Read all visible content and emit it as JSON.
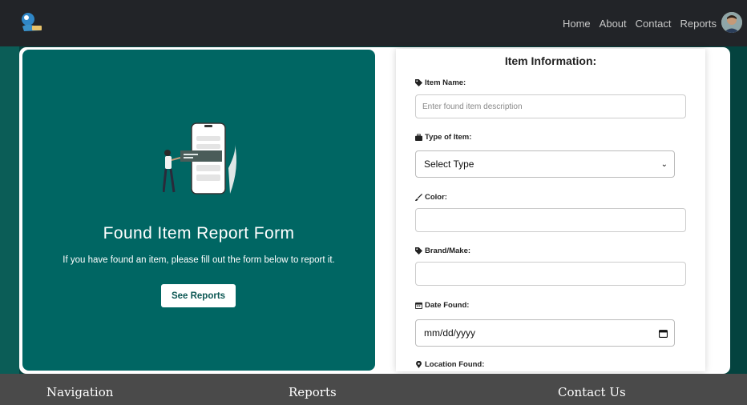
{
  "navbar": {
    "logo_icon": "lost-and-found-logo",
    "links": [
      "Home",
      "About",
      "Contact",
      "Reports"
    ],
    "avatar_icon": "user-avatar"
  },
  "hero": {
    "title": "Found Item Report Form",
    "text": "If you have found an item, please fill out the form below to report it.",
    "button_label": "See Reports",
    "illustration": "person-with-phone-illustration",
    "bg_color": "#006663"
  },
  "form": {
    "title": "Item Information:",
    "fields": {
      "item_name": {
        "label": "Item Name:",
        "icon": "tag-icon",
        "placeholder": "Enter found item description",
        "value": ""
      },
      "type": {
        "label": "Type of Item:",
        "icon": "briefcase-icon",
        "selected": "Select Type"
      },
      "color": {
        "label": "Color:",
        "icon": "brush-icon",
        "value": ""
      },
      "brand": {
        "label": "Brand/Make:",
        "icon": "tag-icon",
        "value": ""
      },
      "date_found": {
        "label": "Date Found:",
        "icon": "calendar-icon",
        "placeholder": "mm/dd/yyyy"
      },
      "location": {
        "label": "Location Found:",
        "icon": "map-marker-icon"
      }
    }
  },
  "footer": {
    "headings": [
      "Navigation",
      "Reports",
      "Contact Us"
    ]
  }
}
